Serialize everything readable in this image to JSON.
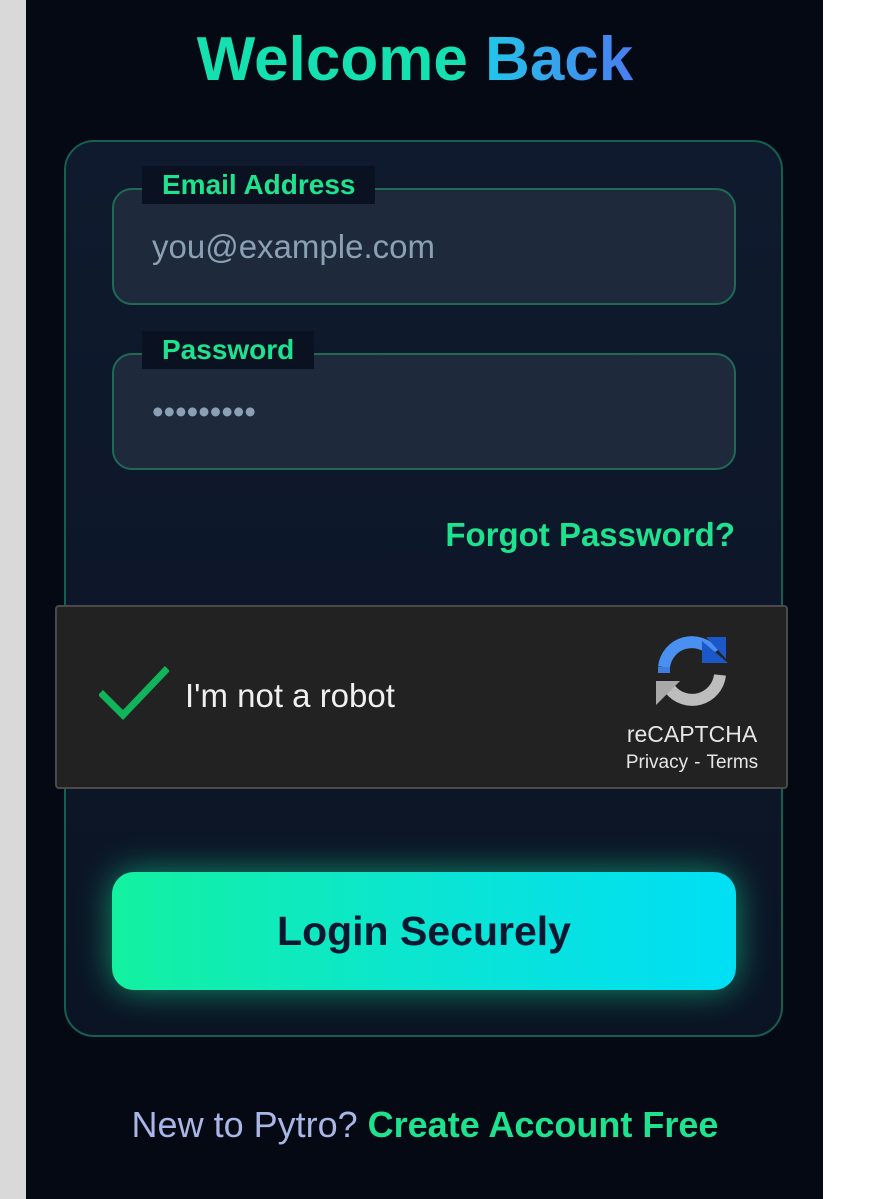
{
  "header": {
    "title_part1": "Welcome",
    "title_part2": "Back"
  },
  "form": {
    "email": {
      "label": "Email Address",
      "placeholder": "you@example.com",
      "value": ""
    },
    "password": {
      "label": "Password",
      "value": "password1"
    },
    "forgot_link": "Forgot Password?",
    "submit_label": "Login Securely"
  },
  "captcha": {
    "checked": true,
    "label": "I'm not a robot",
    "brand": "reCAPTCHA",
    "privacy": "Privacy",
    "separator": "-",
    "terms": "Terms"
  },
  "footer": {
    "prompt": "New to Pytro?",
    "link": "Create Account Free"
  },
  "colors": {
    "background": "#050914",
    "accent_green": "#1fe28f",
    "title_teal": "#14e0b0",
    "title_blue": "#4a7df0",
    "card_border": "#165e4e",
    "captcha_bg": "#222222"
  },
  "icons": {
    "captcha_check": "checkmark-icon",
    "captcha_logo": "recaptcha-logo-icon"
  }
}
